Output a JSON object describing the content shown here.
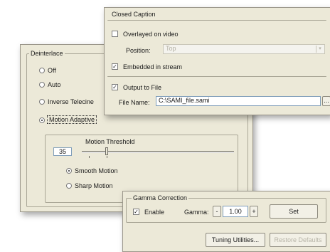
{
  "deinterlace": {
    "title": "Deinterlace",
    "options": [
      {
        "label": "Off",
        "selected": false
      },
      {
        "label": "Auto",
        "selected": false
      },
      {
        "label": "Inverse Telecine",
        "selected": false
      },
      {
        "label": "Motion Adaptive",
        "selected": true
      }
    ],
    "motion_threshold": {
      "label": "Motion Threshold",
      "value": "35",
      "smooth_label": "Smooth Motion",
      "sharp_label": "Sharp Motion",
      "smooth_selected": true
    }
  },
  "closed_caption": {
    "title": "Closed Caption",
    "overlayed_label": "Overlayed on video",
    "overlayed_checked": false,
    "position_label": "Position:",
    "position_value": "Top",
    "embedded_label": "Embedded in stream",
    "embedded_checked": true,
    "output_label": "Output to File",
    "output_checked": true,
    "file_name_label": "File Name:",
    "file_name_value": "C:\\SAMI_file.sami",
    "browse_label": "..."
  },
  "gamma": {
    "title": "Gamma Correction",
    "enable_label": "Enable",
    "enable_checked": true,
    "gamma_label": "Gamma:",
    "gamma_value": "1.00",
    "decrement": "-",
    "increment": "+",
    "set_label": "Set"
  },
  "buttons": {
    "tuning": "Tuning Utilities...",
    "restore": "Restore Defaults"
  },
  "colors": {
    "panel": "#ece9d8",
    "field_border": "#7f9db9"
  }
}
